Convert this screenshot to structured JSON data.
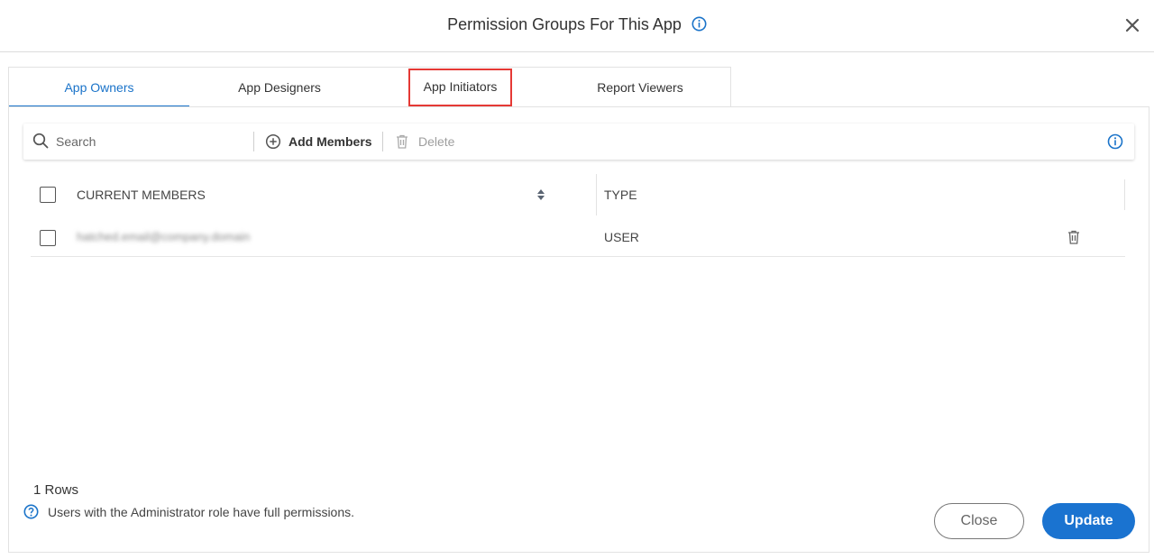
{
  "dialog": {
    "title": "Permission Groups For This App"
  },
  "tabs": [
    {
      "label": "App Owners"
    },
    {
      "label": "App Designers"
    },
    {
      "label": "App Initiators"
    },
    {
      "label": "Report Viewers"
    }
  ],
  "toolbar": {
    "search_placeholder": "Search",
    "add_label": "Add Members",
    "delete_label": "Delete"
  },
  "table": {
    "columns": [
      "CURRENT MEMBERS",
      "TYPE"
    ],
    "rows": [
      {
        "member": "hatched.email@company.domain",
        "type": "USER"
      }
    ]
  },
  "footer": {
    "rows_count": "1 Rows",
    "admin_note": "Users with the Administrator role have full permissions.",
    "close_label": "Close",
    "update_label": "Update"
  },
  "colors": {
    "accent": "#1a73c9",
    "highlight": "#e53935",
    "primary_button": "#1a73d0"
  },
  "icons": [
    "info-icon",
    "close-icon",
    "search-icon",
    "add-circle-icon",
    "trash-icon",
    "sort-icon",
    "help-circle-icon"
  ]
}
